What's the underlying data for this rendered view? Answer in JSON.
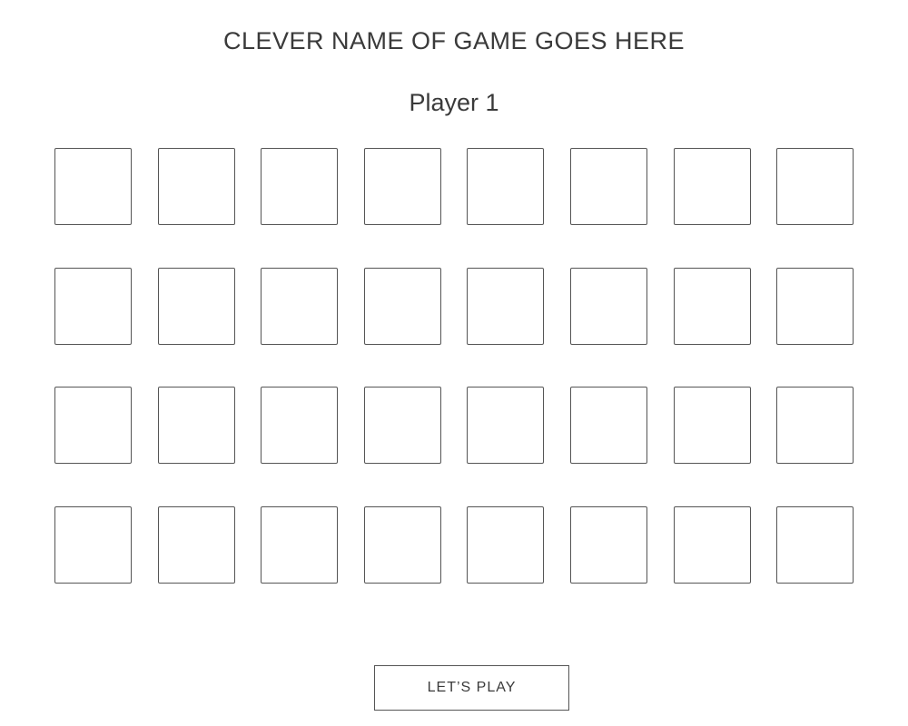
{
  "game": {
    "title": "CLEVER NAME OF GAME GOES HERE",
    "player_label": "Player 1",
    "board": {
      "rows": 4,
      "columns": 8,
      "cards_face_down": 32
    },
    "play_button_label": "LET’S PLAY"
  }
}
